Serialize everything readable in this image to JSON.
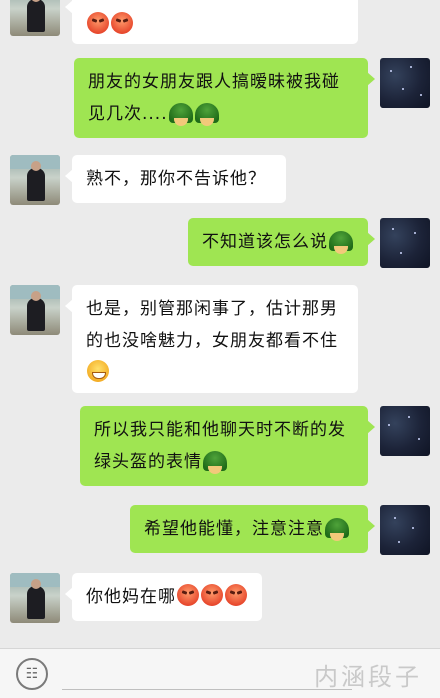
{
  "messages": [
    {
      "side": "in",
      "text": "",
      "emoji": [
        "angry",
        "angry"
      ]
    },
    {
      "side": "out",
      "text": "朋友的女朋友跟人搞暧昧被我碰见几次....",
      "emoji": [
        "turtle",
        "turtle"
      ]
    },
    {
      "side": "in",
      "text": "熟不，那你不告诉他？",
      "emoji": []
    },
    {
      "side": "out",
      "text": "不知道该怎么说",
      "emoji": [
        "turtle"
      ]
    },
    {
      "side": "in",
      "text": "也是，别管那闲事了，估计那男的也没啥魅力，女朋友都看不住",
      "emoji": [
        "grin"
      ]
    },
    {
      "side": "out",
      "text": "所以我只能和他聊天时不断的发绿头盔的表情",
      "emoji": [
        "turtle"
      ]
    },
    {
      "side": "out",
      "text": "希望他能懂，注意注意",
      "emoji": [
        "turtle"
      ]
    },
    {
      "side": "in",
      "text": "你他妈在哪",
      "emoji": [
        "angry",
        "angry",
        "angry"
      ]
    }
  ],
  "composer": {
    "voice_icon": "voice-icon",
    "watermark": "内涵段子"
  }
}
